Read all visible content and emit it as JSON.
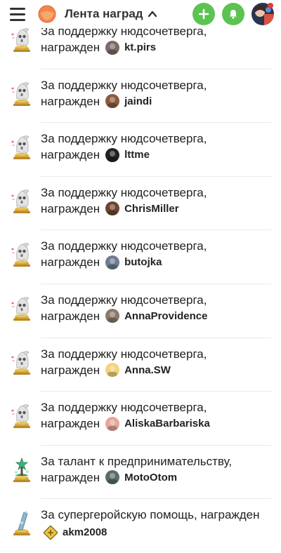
{
  "header": {
    "title": "Лента наград",
    "icons": [
      "menu-icon",
      "logo-icon",
      "chevron-up-icon",
      "plus-icon",
      "bell-icon",
      "avatar"
    ],
    "colors": {
      "accent_green": "#5cc350",
      "logo_orange": "#f2854a"
    }
  },
  "feed": [
    {
      "line1": "За поддержку нюдсочетверга,",
      "line2": "награжден",
      "user": "kt.pirs",
      "trophy": "ghost",
      "avatar_color": "#7a6b66"
    },
    {
      "line1": "За поддержку нюдсочетверга,",
      "line2": "награжден",
      "user": "jaindi",
      "trophy": "ghost",
      "avatar_color": "#8b5a3c"
    },
    {
      "line1": "За поддержку нюдсочетверга,",
      "line2": "награжден",
      "user": "lttme",
      "trophy": "ghost",
      "avatar_color": "#222222"
    },
    {
      "line1": "За поддержку нюдсочетверга,",
      "line2": "награжден",
      "user": "ChrisMiller",
      "trophy": "ghost",
      "avatar_color": "#6e4430"
    },
    {
      "line1": "За поддержку нюдсочетверга,",
      "line2": "награжден",
      "user": "butojka",
      "trophy": "ghost",
      "avatar_color": "#6d7c8e"
    },
    {
      "line1": "За поддержку нюдсочетверга,",
      "line2": "награжден",
      "user": "AnnaProvidence",
      "trophy": "ghost",
      "avatar_color": "#8a7a6a"
    },
    {
      "line1": "За поддержку нюдсочетверга,",
      "line2": "награжден",
      "user": "Anna.SW",
      "trophy": "ghost",
      "avatar_color": "#f4d27a"
    },
    {
      "line1": "За поддержку нюдсочетверга,",
      "line2": "награжден",
      "user": "AliskaBarbariska",
      "trophy": "ghost",
      "avatar_color": "#e8a59a"
    },
    {
      "line1": "За талант к предпринимательству,",
      "line2": "награжден",
      "user": "MotoOtom",
      "trophy": "money",
      "avatar_color": "#5a6b6b"
    },
    {
      "line1": "За супергеройскую помощь, награжден",
      "line2": "",
      "user": "akm2008",
      "trophy": "hero",
      "avatar_color": "#e8c640"
    }
  ]
}
